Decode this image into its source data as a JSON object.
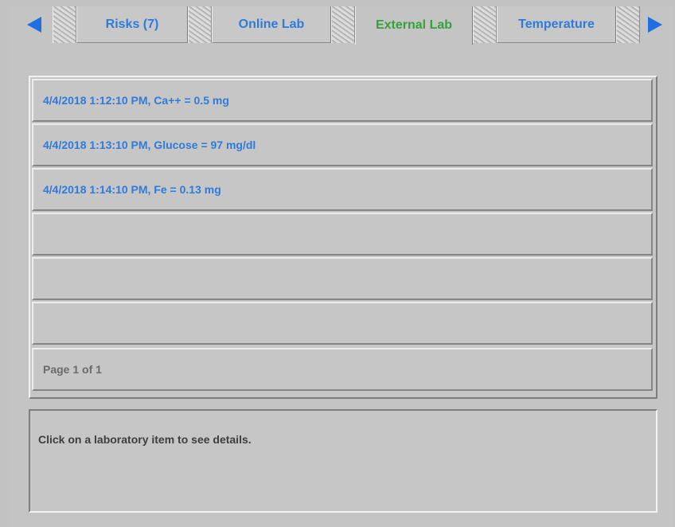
{
  "tabs": [
    {
      "label": "Risks (7)",
      "active": false
    },
    {
      "label": "Online Lab",
      "active": false
    },
    {
      "label": "External Lab",
      "active": true
    },
    {
      "label": "Temperature",
      "active": false
    }
  ],
  "nav": {
    "prev_icon": "left-arrow-icon",
    "next_icon": "right-arrow-icon"
  },
  "lab_items": [
    "4/4/2018 1:12:10 PM, Ca++ = 0.5 mg",
    "4/4/2018 1:13:10 PM, Glucose = 97 mg/dl",
    "4/4/2018 1:14:10 PM, Fe = 0.13 mg",
    "",
    "",
    ""
  ],
  "pager": "Page 1 of 1",
  "details_text": "Click on a laboratory item to see details.",
  "colors": {
    "link": "#2e7bdc",
    "active_tab": "#34a23a",
    "background": "#c2c2c2"
  }
}
